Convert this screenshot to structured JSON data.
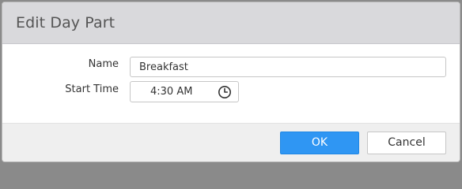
{
  "dialog": {
    "title": "Edit Day Part"
  },
  "form": {
    "name_label": "Name",
    "name_value": "Breakfast",
    "start_time_label": "Start Time",
    "start_time_value": "4:30 AM",
    "clock_icon": "clock-icon"
  },
  "footer": {
    "ok_label": "OK",
    "cancel_label": "Cancel"
  },
  "colors": {
    "primary": "#2f96f3",
    "header_bg": "#d9d9dc",
    "footer_bg": "#efefef"
  }
}
